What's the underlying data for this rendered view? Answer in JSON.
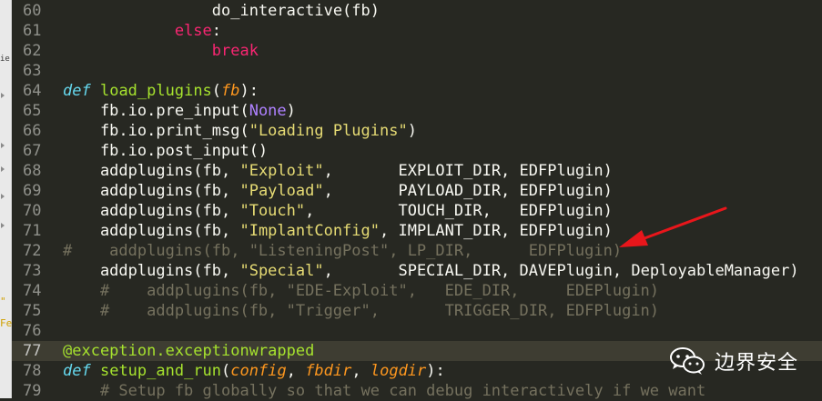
{
  "window": {
    "background": "#272822"
  },
  "sidebar_fragments": [
    "ie",
    "\"",
    "Fe"
  ],
  "editor": {
    "current_line": 77,
    "lines": [
      {
        "n": "60",
        "tokens": [
          [
            "p",
            "                "
          ],
          [
            "p",
            "do_interactive(fb)"
          ]
        ]
      },
      {
        "n": "61",
        "tokens": [
          [
            "p",
            "            "
          ],
          [
            "k",
            "else"
          ],
          [
            "p",
            ":"
          ]
        ]
      },
      {
        "n": "62",
        "tokens": [
          [
            "p",
            "                "
          ],
          [
            "k",
            "break"
          ]
        ]
      },
      {
        "n": "63",
        "tokens": []
      },
      {
        "n": "64",
        "tokens": [
          [
            "s",
            "def"
          ],
          [
            "p",
            " "
          ],
          [
            "f",
            "load_plugins"
          ],
          [
            "p",
            "("
          ],
          [
            "a",
            "fb"
          ],
          [
            "p",
            "):"
          ]
        ]
      },
      {
        "n": "65",
        "tokens": [
          [
            "p",
            "    fb.io.pre_input("
          ],
          [
            "c",
            "None"
          ],
          [
            "p",
            ")"
          ]
        ]
      },
      {
        "n": "66",
        "tokens": [
          [
            "p",
            "    fb.io.print_msg("
          ],
          [
            "str",
            "\"Loading Plugins\""
          ],
          [
            "p",
            ")"
          ]
        ]
      },
      {
        "n": "67",
        "tokens": [
          [
            "p",
            "    fb.io.post_input()"
          ]
        ]
      },
      {
        "n": "68",
        "tokens": [
          [
            "p",
            "    addplugins(fb, "
          ],
          [
            "str",
            "\"Exploit\""
          ],
          [
            "p",
            ",       EXPLOIT_DIR, EDFPlugin)"
          ]
        ]
      },
      {
        "n": "69",
        "tokens": [
          [
            "p",
            "    addplugins(fb, "
          ],
          [
            "str",
            "\"Payload\""
          ],
          [
            "p",
            ",       PAYLOAD_DIR, EDFPlugin)"
          ]
        ]
      },
      {
        "n": "70",
        "tokens": [
          [
            "p",
            "    addplugins(fb, "
          ],
          [
            "str",
            "\"Touch\""
          ],
          [
            "p",
            ",         TOUCH_DIR,   EDFPlugin)"
          ]
        ]
      },
      {
        "n": "71",
        "tokens": [
          [
            "p",
            "    addplugins(fb, "
          ],
          [
            "str",
            "\"ImplantConfig\""
          ],
          [
            "p",
            ", IMPLANT_DIR, EDFPlugin)"
          ]
        ]
      },
      {
        "n": "72",
        "tokens": [
          [
            "cm",
            "#    addplugins(fb, \"ListeningPost\", LP_DIR,      EDFPlugin)"
          ]
        ]
      },
      {
        "n": "73",
        "tokens": [
          [
            "p",
            "    addplugins(fb, "
          ],
          [
            "str",
            "\"Special\""
          ],
          [
            "p",
            ",       SPECIAL_DIR, DAVEPlugin, DeployableManager)"
          ]
        ]
      },
      {
        "n": "74",
        "tokens": [
          [
            "cm",
            "    #    addplugins(fb, \"EDE-Exploit\",   EDE_DIR,     EDEPlugin)"
          ]
        ]
      },
      {
        "n": "75",
        "tokens": [
          [
            "cm",
            "    #    addplugins(fb, \"Trigger\",       TRIGGER_DIR, EDFPlugin)"
          ]
        ]
      },
      {
        "n": "76",
        "tokens": []
      },
      {
        "n": "77",
        "tokens": [
          [
            "d",
            "@exception.exceptionwrapped"
          ]
        ]
      },
      {
        "n": "78",
        "tokens": [
          [
            "s",
            "def"
          ],
          [
            "p",
            " "
          ],
          [
            "f",
            "setup_and_run"
          ],
          [
            "p",
            "("
          ],
          [
            "a",
            "config"
          ],
          [
            "p",
            ", "
          ],
          [
            "a",
            "fbdir"
          ],
          [
            "p",
            ", "
          ],
          [
            "a",
            "logdir"
          ],
          [
            "p",
            "):"
          ]
        ]
      },
      {
        "n": "79",
        "tokens": [
          [
            "cm",
            "    # Setup fb globally so that we can debug interactively if we want"
          ]
        ]
      }
    ]
  },
  "annotation": {
    "color": "#e8161b",
    "icon": "arrow-icon"
  },
  "watermark": {
    "icon": "wechat-icon",
    "text": "边界安全"
  }
}
